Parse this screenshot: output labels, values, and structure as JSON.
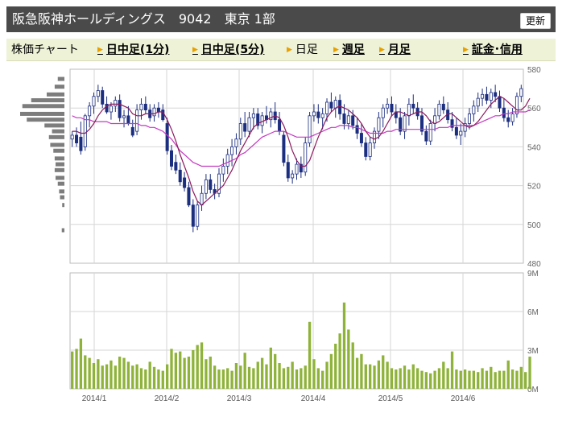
{
  "header": {
    "title": "阪急阪神ホールディングス　9042　東京 1部",
    "refresh_label": "更新"
  },
  "tabs": [
    {
      "label": "株価チャート",
      "link": false,
      "arrow": false
    },
    {
      "label": "日中足(1分)",
      "link": true,
      "arrow": true
    },
    {
      "label": "日中足(5分)",
      "link": true,
      "arrow": true
    },
    {
      "label": "日足",
      "link": false,
      "arrow": true
    },
    {
      "label": "週足",
      "link": true,
      "arrow": true
    },
    {
      "label": "月足",
      "link": true,
      "arrow": true
    },
    {
      "label": "証金･信用",
      "link": true,
      "arrow": true
    }
  ],
  "chart_data": [
    {
      "type": "candlestick",
      "ylim": [
        480,
        580
      ],
      "yticks": [
        480,
        500,
        520,
        540,
        560,
        580
      ],
      "xticks": [
        "2014/1",
        "2014/2",
        "2014/3",
        "2014/4",
        "2014/5",
        "2014/6"
      ],
      "grid": true,
      "candle_color": "#1c2e80",
      "ma_short_color": "#8b1a5e",
      "ma_long_color": "#c23ac0",
      "candles": [
        {
          "o": 544,
          "h": 548,
          "l": 540,
          "c": 546
        },
        {
          "o": 546,
          "h": 550,
          "l": 540,
          "c": 542
        },
        {
          "o": 545,
          "h": 553,
          "l": 536,
          "c": 538
        },
        {
          "o": 540,
          "h": 557,
          "l": 538,
          "c": 556
        },
        {
          "o": 556,
          "h": 563,
          "l": 550,
          "c": 561
        },
        {
          "o": 561,
          "h": 568,
          "l": 557,
          "c": 566
        },
        {
          "o": 566,
          "h": 572,
          "l": 563,
          "c": 569
        },
        {
          "o": 569,
          "h": 571,
          "l": 560,
          "c": 562
        },
        {
          "o": 562,
          "h": 566,
          "l": 557,
          "c": 558
        },
        {
          "o": 558,
          "h": 563,
          "l": 554,
          "c": 561
        },
        {
          "o": 561,
          "h": 566,
          "l": 558,
          "c": 564
        },
        {
          "o": 564,
          "h": 567,
          "l": 553,
          "c": 555
        },
        {
          "o": 555,
          "h": 559,
          "l": 550,
          "c": 556
        },
        {
          "o": 556,
          "h": 561,
          "l": 551,
          "c": 552
        },
        {
          "o": 550,
          "h": 554,
          "l": 545,
          "c": 546
        },
        {
          "o": 548,
          "h": 562,
          "l": 546,
          "c": 559
        },
        {
          "o": 559,
          "h": 565,
          "l": 554,
          "c": 562
        },
        {
          "o": 562,
          "h": 566,
          "l": 557,
          "c": 559
        },
        {
          "o": 559,
          "h": 562,
          "l": 553,
          "c": 555
        },
        {
          "o": 556,
          "h": 562,
          "l": 553,
          "c": 560
        },
        {
          "o": 560,
          "h": 563,
          "l": 555,
          "c": 558
        },
        {
          "o": 559,
          "h": 562,
          "l": 553,
          "c": 554
        },
        {
          "o": 552,
          "h": 555,
          "l": 536,
          "c": 538
        },
        {
          "o": 538,
          "h": 541,
          "l": 528,
          "c": 530
        },
        {
          "o": 532,
          "h": 536,
          "l": 526,
          "c": 528
        },
        {
          "o": 528,
          "h": 532,
          "l": 520,
          "c": 522
        },
        {
          "o": 524,
          "h": 527,
          "l": 517,
          "c": 519
        },
        {
          "o": 519,
          "h": 522,
          "l": 509,
          "c": 510
        },
        {
          "o": 510,
          "h": 513,
          "l": 496,
          "c": 499
        },
        {
          "o": 499,
          "h": 512,
          "l": 497,
          "c": 510
        },
        {
          "o": 510,
          "h": 520,
          "l": 507,
          "c": 516
        },
        {
          "o": 516,
          "h": 526,
          "l": 513,
          "c": 523
        },
        {
          "o": 523,
          "h": 526,
          "l": 516,
          "c": 518
        },
        {
          "o": 518,
          "h": 521,
          "l": 513,
          "c": 516
        },
        {
          "o": 516,
          "h": 529,
          "l": 514,
          "c": 526
        },
        {
          "o": 526,
          "h": 534,
          "l": 522,
          "c": 530
        },
        {
          "o": 530,
          "h": 539,
          "l": 526,
          "c": 536
        },
        {
          "o": 536,
          "h": 544,
          "l": 530,
          "c": 540
        },
        {
          "o": 540,
          "h": 547,
          "l": 536,
          "c": 544
        },
        {
          "o": 544,
          "h": 555,
          "l": 541,
          "c": 552
        },
        {
          "o": 552,
          "h": 558,
          "l": 545,
          "c": 548
        },
        {
          "o": 548,
          "h": 558,
          "l": 545,
          "c": 555
        },
        {
          "o": 555,
          "h": 560,
          "l": 549,
          "c": 557
        },
        {
          "o": 557,
          "h": 560,
          "l": 549,
          "c": 551
        },
        {
          "o": 551,
          "h": 558,
          "l": 547,
          "c": 556
        },
        {
          "o": 556,
          "h": 561,
          "l": 552,
          "c": 554
        },
        {
          "o": 554,
          "h": 560,
          "l": 550,
          "c": 558
        },
        {
          "o": 558,
          "h": 563,
          "l": 552,
          "c": 554
        },
        {
          "o": 554,
          "h": 558,
          "l": 546,
          "c": 548
        },
        {
          "o": 546,
          "h": 548,
          "l": 530,
          "c": 532
        },
        {
          "o": 532,
          "h": 536,
          "l": 522,
          "c": 524
        },
        {
          "o": 524,
          "h": 528,
          "l": 521,
          "c": 526
        },
        {
          "o": 526,
          "h": 534,
          "l": 523,
          "c": 531
        },
        {
          "o": 531,
          "h": 535,
          "l": 524,
          "c": 527
        },
        {
          "o": 527,
          "h": 545,
          "l": 525,
          "c": 542
        },
        {
          "o": 542,
          "h": 558,
          "l": 540,
          "c": 556
        },
        {
          "o": 556,
          "h": 562,
          "l": 553,
          "c": 558
        },
        {
          "o": 558,
          "h": 562,
          "l": 552,
          "c": 555
        },
        {
          "o": 555,
          "h": 560,
          "l": 549,
          "c": 557
        },
        {
          "o": 557,
          "h": 565,
          "l": 553,
          "c": 563
        },
        {
          "o": 563,
          "h": 568,
          "l": 558,
          "c": 560
        },
        {
          "o": 560,
          "h": 566,
          "l": 555,
          "c": 564
        },
        {
          "o": 564,
          "h": 567,
          "l": 554,
          "c": 557
        },
        {
          "o": 557,
          "h": 562,
          "l": 549,
          "c": 552
        },
        {
          "o": 552,
          "h": 559,
          "l": 549,
          "c": 556
        },
        {
          "o": 556,
          "h": 559,
          "l": 549,
          "c": 551
        },
        {
          "o": 551,
          "h": 555,
          "l": 544,
          "c": 547
        },
        {
          "o": 547,
          "h": 552,
          "l": 540,
          "c": 542
        },
        {
          "o": 542,
          "h": 545,
          "l": 533,
          "c": 535
        },
        {
          "o": 535,
          "h": 545,
          "l": 533,
          "c": 542
        },
        {
          "o": 542,
          "h": 550,
          "l": 539,
          "c": 548
        },
        {
          "o": 548,
          "h": 558,
          "l": 544,
          "c": 555
        },
        {
          "o": 555,
          "h": 562,
          "l": 550,
          "c": 560
        },
        {
          "o": 560,
          "h": 565,
          "l": 557,
          "c": 562
        },
        {
          "o": 562,
          "h": 566,
          "l": 556,
          "c": 558
        },
        {
          "o": 558,
          "h": 562,
          "l": 552,
          "c": 555
        },
        {
          "o": 555,
          "h": 560,
          "l": 546,
          "c": 548
        },
        {
          "o": 548,
          "h": 558,
          "l": 544,
          "c": 556
        },
        {
          "o": 556,
          "h": 565,
          "l": 551,
          "c": 562
        },
        {
          "o": 562,
          "h": 567,
          "l": 557,
          "c": 560
        },
        {
          "o": 560,
          "h": 563,
          "l": 554,
          "c": 556
        },
        {
          "o": 556,
          "h": 560,
          "l": 546,
          "c": 548
        },
        {
          "o": 548,
          "h": 551,
          "l": 541,
          "c": 543
        },
        {
          "o": 543,
          "h": 554,
          "l": 541,
          "c": 552
        },
        {
          "o": 552,
          "h": 560,
          "l": 548,
          "c": 556
        },
        {
          "o": 556,
          "h": 564,
          "l": 554,
          "c": 562
        },
        {
          "o": 562,
          "h": 566,
          "l": 557,
          "c": 559
        },
        {
          "o": 559,
          "h": 563,
          "l": 552,
          "c": 554
        },
        {
          "o": 554,
          "h": 558,
          "l": 548,
          "c": 550
        },
        {
          "o": 550,
          "h": 555,
          "l": 544,
          "c": 546
        },
        {
          "o": 546,
          "h": 552,
          "l": 541,
          "c": 548
        },
        {
          "o": 548,
          "h": 555,
          "l": 545,
          "c": 552
        },
        {
          "o": 552,
          "h": 560,
          "l": 549,
          "c": 557
        },
        {
          "o": 557,
          "h": 564,
          "l": 553,
          "c": 561
        },
        {
          "o": 561,
          "h": 568,
          "l": 558,
          "c": 565
        },
        {
          "o": 565,
          "h": 570,
          "l": 561,
          "c": 567
        },
        {
          "o": 567,
          "h": 571,
          "l": 562,
          "c": 564
        },
        {
          "o": 564,
          "h": 570,
          "l": 560,
          "c": 568
        },
        {
          "o": 568,
          "h": 572,
          "l": 563,
          "c": 566
        },
        {
          "o": 566,
          "h": 569,
          "l": 558,
          "c": 560
        },
        {
          "o": 560,
          "h": 565,
          "l": 553,
          "c": 555
        },
        {
          "o": 555,
          "h": 559,
          "l": 550,
          "c": 553
        },
        {
          "o": 553,
          "h": 560,
          "l": 551,
          "c": 557
        },
        {
          "o": 557,
          "h": 568,
          "l": 555,
          "c": 566
        },
        {
          "o": 566,
          "h": 572,
          "l": 563,
          "c": 570
        }
      ],
      "ma_short": [
        548,
        548,
        547,
        547,
        549,
        552,
        556,
        559,
        561,
        562,
        562,
        562,
        561,
        560,
        557,
        556,
        556,
        557,
        557,
        557,
        558,
        558,
        554,
        549,
        543,
        536,
        530,
        524,
        517,
        512,
        510,
        512,
        514,
        516,
        518,
        520,
        524,
        528,
        533,
        538,
        542,
        546,
        550,
        552,
        553,
        554,
        555,
        556,
        555,
        551,
        545,
        538,
        533,
        530,
        530,
        533,
        539,
        545,
        550,
        555,
        558,
        560,
        561,
        560,
        559,
        557,
        555,
        552,
        548,
        545,
        544,
        545,
        548,
        552,
        556,
        558,
        558,
        557,
        556,
        557,
        558,
        558,
        556,
        553,
        552,
        553,
        555,
        557,
        557,
        555,
        553,
        551,
        550,
        551,
        553,
        556,
        559,
        562,
        564,
        566,
        565,
        563,
        561,
        559,
        559,
        561,
        565
      ],
      "ma_long": [
        556,
        555,
        555,
        554,
        554,
        553,
        553,
        553,
        553,
        552,
        552,
        552,
        552,
        552,
        552,
        552,
        551,
        551,
        550,
        550,
        549,
        548,
        546,
        544,
        541,
        538,
        536,
        534,
        532,
        531,
        530,
        530,
        530,
        530,
        530,
        531,
        532,
        533,
        534,
        536,
        537,
        539,
        541,
        543,
        545,
        546,
        547,
        548,
        548,
        548,
        547,
        546,
        545,
        545,
        545,
        545,
        546,
        547,
        548,
        549,
        550,
        550,
        551,
        551,
        551,
        550,
        550,
        549,
        548,
        547,
        547,
        547,
        547,
        548,
        548,
        549,
        549,
        549,
        549,
        549,
        549,
        549,
        549,
        549,
        549,
        550,
        550,
        550,
        551,
        551,
        551,
        551,
        551,
        551,
        552,
        553,
        554,
        555,
        556,
        556,
        557,
        557,
        558,
        558,
        558,
        558,
        559
      ],
      "volume_profile": [
        {
          "price": 575,
          "level": 0.15
        },
        {
          "price": 571,
          "level": 0.22
        },
        {
          "price": 567,
          "level": 0.4
        },
        {
          "price": 564,
          "level": 0.75
        },
        {
          "price": 561,
          "level": 0.95
        },
        {
          "price": 557,
          "level": 1.0
        },
        {
          "price": 554,
          "level": 0.85
        },
        {
          "price": 551,
          "level": 0.45
        },
        {
          "price": 548,
          "level": 0.28
        },
        {
          "price": 545,
          "level": 0.35
        },
        {
          "price": 541,
          "level": 0.32
        },
        {
          "price": 538,
          "level": 0.25
        },
        {
          "price": 534,
          "level": 0.22
        },
        {
          "price": 531,
          "level": 0.2
        },
        {
          "price": 528,
          "level": 0.22
        },
        {
          "price": 524,
          "level": 0.2
        },
        {
          "price": 521,
          "level": 0.15
        },
        {
          "price": 517,
          "level": 0.12
        },
        {
          "price": 514,
          "level": 0.1
        },
        {
          "price": 510,
          "level": 0.05
        },
        {
          "price": 497,
          "level": 0.06
        }
      ]
    },
    {
      "type": "bar",
      "ylim": [
        0,
        9
      ],
      "yticks": [
        "0M",
        "3M",
        "6M",
        "9M"
      ],
      "bar_color": "#8fb33a",
      "values": [
        2.9,
        3.1,
        3.9,
        2.6,
        2.4,
        2.0,
        2.3,
        1.8,
        1.9,
        2.2,
        1.8,
        2.5,
        2.4,
        2.1,
        1.8,
        1.9,
        1.6,
        1.5,
        2.1,
        1.7,
        1.5,
        1.4,
        1.9,
        3.1,
        2.8,
        2.9,
        2.4,
        2.5,
        3.0,
        3.4,
        3.6,
        2.3,
        2.5,
        1.8,
        1.5,
        1.5,
        1.6,
        1.4,
        2.0,
        1.8,
        2.8,
        1.7,
        1.6,
        2.1,
        2.4,
        1.9,
        3.2,
        2.7,
        2.0,
        1.6,
        1.7,
        2.1,
        1.5,
        1.6,
        1.8,
        5.2,
        2.3,
        1.6,
        1.4,
        2.1,
        2.7,
        3.5,
        4.3,
        6.7,
        4.6,
        3.6,
        2.4,
        2.7,
        1.9,
        1.9,
        1.8,
        2.2,
        2.6,
        2.1,
        1.6,
        1.5,
        1.6,
        1.8,
        1.5,
        1.9,
        1.6,
        1.4,
        1.3,
        1.2,
        1.4,
        1.6,
        2.1,
        1.6,
        2.9,
        1.5,
        1.4,
        1.5,
        1.4,
        1.4,
        1.3,
        1.6,
        1.4,
        1.7,
        1.3,
        1.4,
        1.4,
        2.2,
        1.5,
        1.4,
        1.7,
        1.3,
        2.5
      ]
    }
  ]
}
